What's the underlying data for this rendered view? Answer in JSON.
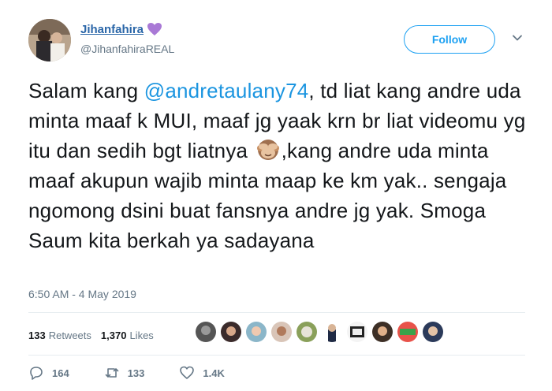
{
  "user": {
    "display_name": "Jihanfahira",
    "handle": "@JihanfahiraREAL",
    "verified_emoji": "purple-heart-icon"
  },
  "follow_button": {
    "label": "Follow"
  },
  "tweet": {
    "part1": "Salam kang ",
    "mention": "@andretaulany74",
    "part2": ", td liat kang andre uda minta maaf k MUI, maaf jg yaak krn br liat videomu yg itu dan sedih bgt liatnya ",
    "emoji": "see-no-evil-monkey-icon",
    "part3": ",kang andre uda minta maaf akupun wajib minta maap ke km yak.. sengaja ngomong dsini buat fansnya andre jg yak. Smoga Saum kita berkah ya sadayana"
  },
  "timestamp": "6:50 AM - 4 May 2019",
  "stats": {
    "retweets_count": "133",
    "retweets_label": "Retweets",
    "likes_count": "1,370",
    "likes_label": "Likes"
  },
  "actions": {
    "replies": "164",
    "retweets": "133",
    "likes": "1.4K"
  },
  "colors": {
    "link": "#1b95e0",
    "follow": "#1da1f2",
    "muted": "#657786",
    "name": "#2a66a8"
  }
}
